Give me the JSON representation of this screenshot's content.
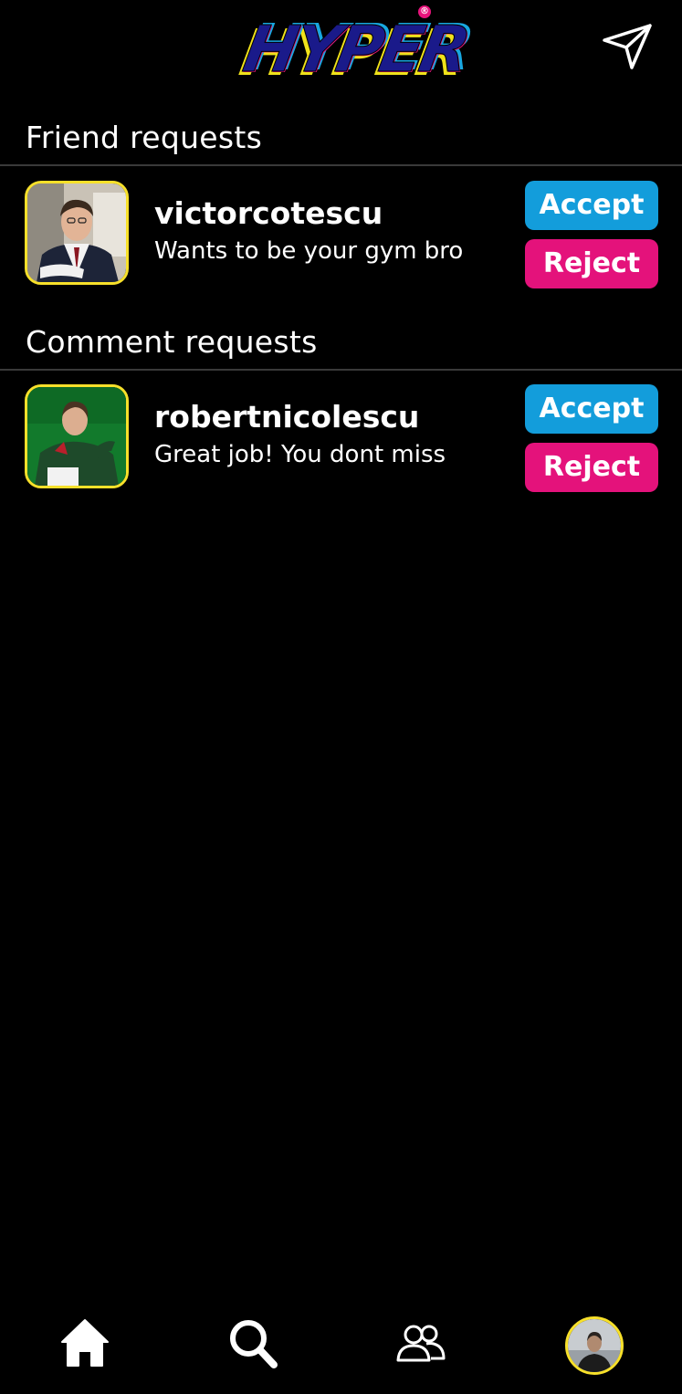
{
  "app": {
    "logo_text": "HYPER",
    "logo_registered": "®"
  },
  "colors": {
    "accent_yellow": "#f7e02a",
    "accept_blue": "#139ddb",
    "reject_pink": "#e4127b",
    "background": "#000000"
  },
  "friend_requests": {
    "title": "Friend requests",
    "items": [
      {
        "username": "victorcotescu",
        "message": "Wants to be your gym bro",
        "accept_label": "Accept",
        "reject_label": "Reject"
      }
    ]
  },
  "comment_requests": {
    "title": "Comment requests",
    "items": [
      {
        "username": "robertnicolescu",
        "message": "Great job! You dont miss",
        "accept_label": "Accept",
        "reject_label": "Reject"
      }
    ]
  },
  "icons": {
    "send": "send-icon",
    "home": "home-icon",
    "search": "search-icon",
    "friends": "friends-icon",
    "profile": "profile-avatar"
  }
}
